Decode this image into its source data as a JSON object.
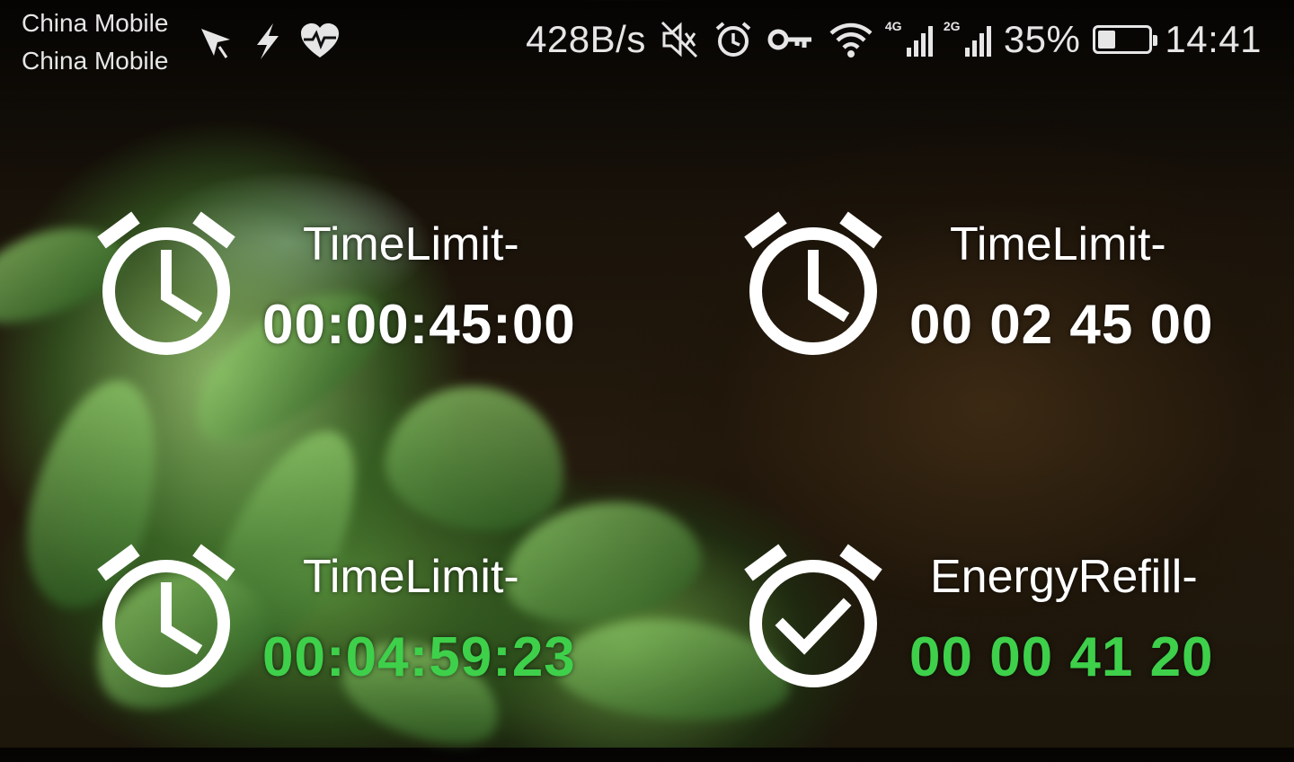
{
  "status_bar": {
    "carrier_1": "China Mobile",
    "carrier_2": "China Mobile",
    "left_icons": [
      "location-arrow-icon",
      "flash-icon",
      "health-heart-icon"
    ],
    "network_speed": "428B/s",
    "right_icons": [
      "mute-icon",
      "alarm-icon",
      "vpn-key-icon",
      "wifi-icon"
    ],
    "signal_1_tag": "4G",
    "signal_2_tag": "2G",
    "battery_percent_text": "35%",
    "battery_level": 0.35,
    "time": "14:41"
  },
  "timers": [
    {
      "label": "TimeLimit-",
      "value": "00:00:45:00",
      "icon": "stopwatch-clock-icon",
      "color": "#ffffff"
    },
    {
      "label": "TimeLimit-",
      "value": "00 02 45 00",
      "icon": "stopwatch-clock-icon",
      "color": "#ffffff"
    },
    {
      "label": "TimeLimit-",
      "value": "00:04:59:23",
      "icon": "stopwatch-clock-icon",
      "color": "#3ed04a"
    },
    {
      "label": "EnergyRefill-",
      "value": "00 00 41 20",
      "icon": "stopwatch-check-icon",
      "color": "#3ed04a"
    }
  ],
  "colors": {
    "active_green": "#3ed04a",
    "text_white": "#ffffff"
  }
}
